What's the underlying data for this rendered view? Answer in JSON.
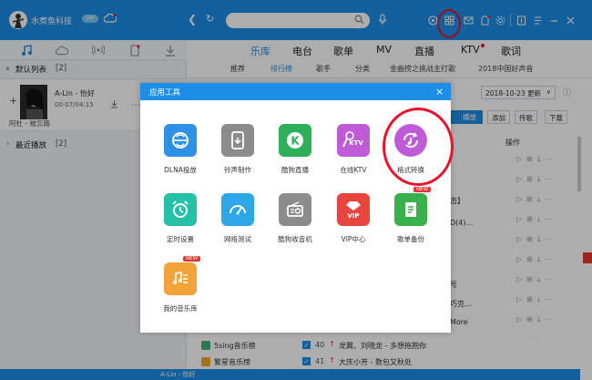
{
  "app": {
    "title": "水煮鱼科技",
    "vip": "VIP"
  },
  "main_tabs": [
    "乐库",
    "电台",
    "歌单",
    "MV",
    "直播",
    "KTV",
    "歌词"
  ],
  "sub_tabs": [
    "推荐",
    "排行榜",
    "歌手",
    "分类",
    "金曲捞之挑战主打歌",
    "2018中国好声音"
  ],
  "sidebar": {
    "default_list": "默认列表",
    "default_count": "[2]",
    "song_title": "A-Lin - 怡好",
    "song_time": "00:07/04:15",
    "song_source": "阿杜 - 被忘路",
    "recent": "最近播放",
    "recent_count": "[2]"
  },
  "toolbar": {
    "date": "2018-10-23 更新",
    "play": "播放",
    "add": "添加",
    "share": "传歌",
    "download": "下载",
    "ops": "操作"
  },
  "bg_fragments": {
    "r1": "击】",
    "r2": "D(4)...",
    "r3": "号",
    "r4": "巧克...",
    "r5": "More"
  },
  "bottom_rows": [
    {
      "source": "5sing音乐榜",
      "rank": "",
      "song": ""
    },
    {
      "source": "",
      "rank": "40",
      "song": "龙翼、刘晓龙 - 多想拖抱你"
    },
    {
      "source": "繁星音乐榜",
      "rank": "41",
      "song": "大庆小芳 - 数包又秋处"
    }
  ],
  "player": {
    "now": "A-Lin - 怡好"
  },
  "modal": {
    "title": "应用工具",
    "tools": [
      {
        "label": "DLNA投放",
        "color": "#2e91e6"
      },
      {
        "label": "铃声制作",
        "color": "#8c8c8c"
      },
      {
        "label": "酷狗直播",
        "color": "#2eb05a"
      },
      {
        "label": "在线KTV",
        "color": "#c05bd8"
      },
      {
        "label": "格式转换",
        "color": "#c05bd8"
      },
      {
        "label": "定时设置",
        "color": "#24c0a8"
      },
      {
        "label": "网络测试",
        "color": "#2ea5e6"
      },
      {
        "label": "酷狗收音机",
        "color": "#8c8c8c"
      },
      {
        "label": "VIP中心",
        "color": "#e8453e"
      },
      {
        "label": "歌单备份",
        "color": "#3ab04a"
      },
      {
        "label": "我的音乐库",
        "color": "#f2a33a"
      }
    ],
    "new_badge": "NEW"
  },
  "colors": {
    "brand": "#1e8ee6",
    "highlight": "#e8132b"
  }
}
